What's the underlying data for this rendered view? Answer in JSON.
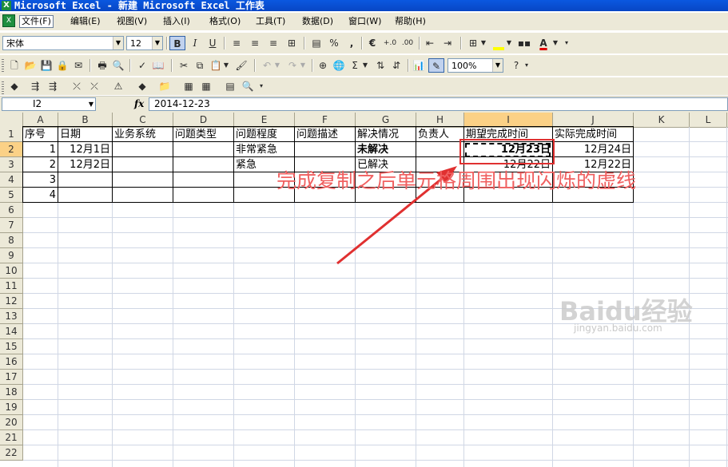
{
  "window": {
    "title": "Microsoft Excel - 新建 Microsoft Excel 工作表",
    "app_icon": "excel-icon"
  },
  "menubar": {
    "items": [
      {
        "label": "文件(F)",
        "active": true
      },
      {
        "label": "编辑(E)"
      },
      {
        "label": "视图(V)"
      },
      {
        "label": "插入(I)"
      },
      {
        "label": "格式(O)"
      },
      {
        "label": "工具(T)"
      },
      {
        "label": "数据(D)"
      },
      {
        "label": "窗口(W)"
      },
      {
        "label": "帮助(H)"
      }
    ]
  },
  "formatting_toolbar": {
    "font_name": "宋体",
    "font_size": "12",
    "bold_label": "B",
    "italic_label": "I",
    "underline_label": "U",
    "percent_label": "%",
    "comma_label": ",",
    "euro_label": "€",
    "increase_decimal_label": "+.0",
    "decrease_decimal_label": ".00",
    "font_color_label": "A",
    "font_color": "#e00000",
    "fill_color": "#ffff00"
  },
  "standard_toolbar": {
    "zoom": "100%",
    "sum_label": "Σ"
  },
  "formula_bar": {
    "name_box": "I2",
    "fx_label": "fx",
    "formula": "2014-12-23"
  },
  "sheet": {
    "columns": [
      "A",
      "B",
      "C",
      "D",
      "E",
      "F",
      "G",
      "H",
      "I",
      "J",
      "K",
      "L"
    ],
    "selected_column": "I",
    "rows": [
      "1",
      "2",
      "3",
      "4",
      "5",
      "6",
      "7",
      "8",
      "9",
      "10",
      "11",
      "12",
      "13",
      "14",
      "15",
      "16",
      "17",
      "18",
      "19",
      "20",
      "21",
      "22"
    ],
    "selected_row": "2",
    "header_row": [
      "序号",
      "日期",
      "业务系统",
      "问题类型",
      "问题程度",
      "问题描述",
      "解决情况",
      "负责人",
      "期望完成时间",
      "实际完成时间"
    ],
    "data_rows": [
      [
        "1",
        "12月1日",
        "",
        "",
        "非常紧急",
        "",
        "未解决",
        "",
        "12月23日",
        "12月24日"
      ],
      [
        "2",
        "12月2日",
        "",
        "",
        "紧急",
        "",
        "已解决",
        "",
        "12月22日",
        "12月22日"
      ],
      [
        "3",
        "",
        "",
        "",
        "",
        "",
        "",
        "",
        "",
        ""
      ],
      [
        "4",
        "",
        "",
        "",
        "",
        "",
        "",
        "",
        "",
        ""
      ]
    ]
  },
  "annotation": {
    "text": "完成复制之后单元格周围出现闪烁的虚线",
    "color": "#f06060",
    "box_color": "#e03030"
  },
  "watermark": {
    "logo_text": "Baidu经验",
    "url": "jingyan.baidu.com"
  }
}
